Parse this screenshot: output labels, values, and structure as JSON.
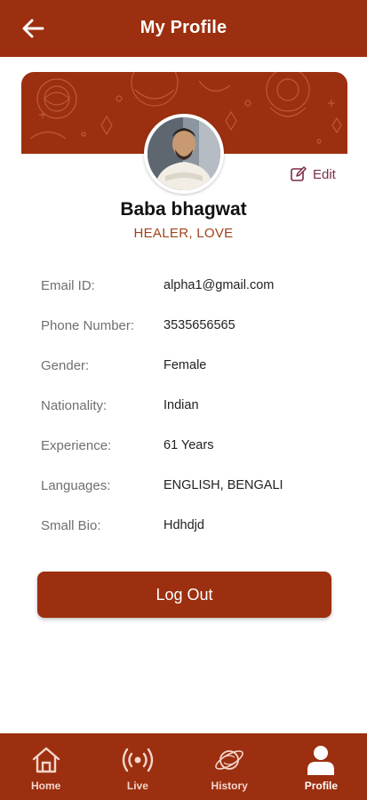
{
  "header": {
    "title": "My Profile"
  },
  "profile": {
    "name": "Baba bhagwat",
    "specialties": "HEALER, LOVE",
    "edit_label": "Edit"
  },
  "details": [
    {
      "label": "Email ID:",
      "value": "alpha1@gmail.com"
    },
    {
      "label": "Phone Number:",
      "value": "3535656565"
    },
    {
      "label": "Gender:",
      "value": "Female"
    },
    {
      "label": "Nationality:",
      "value": "Indian"
    },
    {
      "label": "Experience:",
      "value": "61 Years"
    },
    {
      "label": "Languages:",
      "value": "ENGLISH, BENGALI"
    },
    {
      "label": "Small Bio:",
      "value": "Hdhdjd"
    }
  ],
  "actions": {
    "logout_label": "Log Out"
  },
  "bottom_nav": [
    {
      "label": "Home",
      "icon": "home-icon"
    },
    {
      "label": "Live",
      "icon": "live-broadcast-icon"
    },
    {
      "label": "History",
      "icon": "planet-history-icon"
    },
    {
      "label": "Profile",
      "icon": "person-icon",
      "active": true
    }
  ],
  "colors": {
    "primary": "#9c2f0f",
    "accent_text": "#a0421c",
    "edit": "#7a2d43"
  }
}
